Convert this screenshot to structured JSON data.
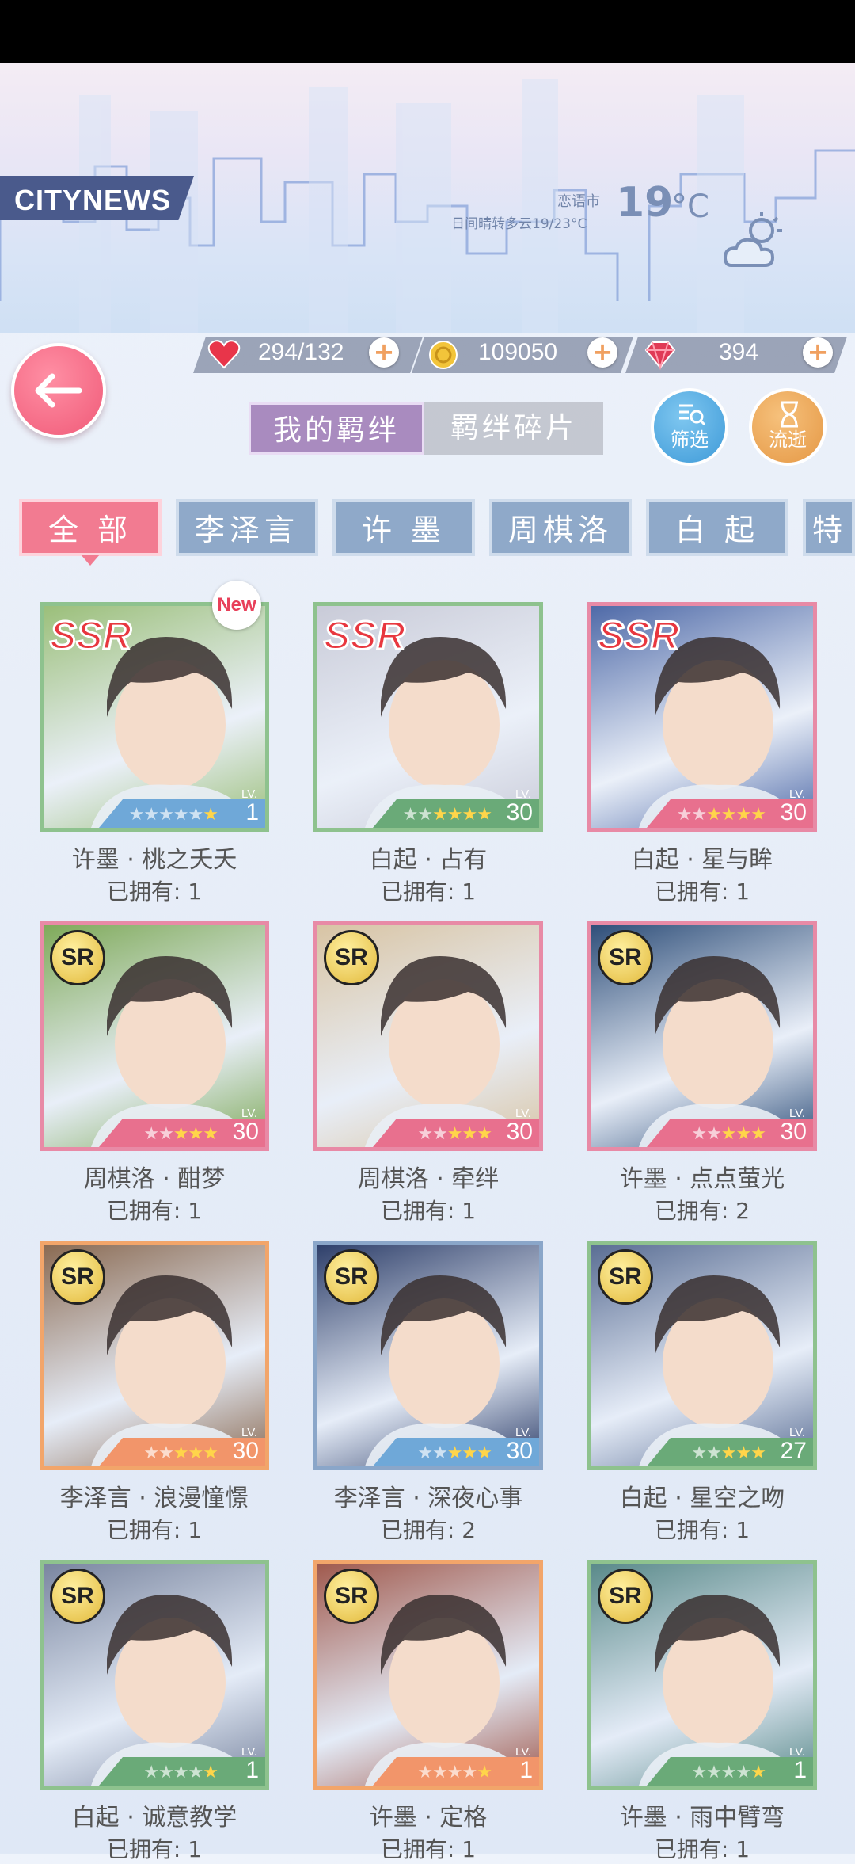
{
  "header": {
    "brand": "CITYNEWS",
    "city": "恋语市",
    "weather_desc": "日间晴转多云19/23°C",
    "temp_value": "19",
    "temp_unit": "°C"
  },
  "resources": {
    "stamina": "294/132",
    "gold": "109050",
    "diamonds": "394"
  },
  "segment_tabs": {
    "active": "我的羁绊",
    "inactive": "羁绊碎片"
  },
  "buttons": {
    "filter": "筛选",
    "flow": "流逝"
  },
  "categories": [
    "全 部",
    "李泽言",
    "许 墨",
    "周棋洛",
    "白 起",
    "特殊"
  ],
  "cards": [
    {
      "name": "许墨 · 桃之夭夭",
      "owned": "已拥有: 1",
      "level": "1",
      "rarity": "SSR",
      "is_new": true,
      "new_label": "New",
      "stars_filled": 1,
      "stars_total": 6,
      "frame": "#8ec28e",
      "band": "#6fa8d8",
      "bg": "#9bbf7a"
    },
    {
      "name": "白起 · 占有",
      "owned": "已拥有: 1",
      "level": "30",
      "rarity": "SSR",
      "stars_filled": 4,
      "stars_total": 6,
      "frame": "#8ec28e",
      "band": "#6aaa78",
      "bg": "#c9cbd8"
    },
    {
      "name": "白起 · 星与眸",
      "owned": "已拥有: 1",
      "level": "30",
      "rarity": "SSR",
      "stars_filled": 4,
      "stars_total": 6,
      "frame": "#e88aa6",
      "band": "#e8708e",
      "bg": "#4f6aa8"
    },
    {
      "name": "周棋洛 · 酣梦",
      "owned": "已拥有: 1",
      "level": "30",
      "rarity": "SR",
      "stars_filled": 3,
      "stars_total": 5,
      "frame": "#e88aa6",
      "band": "#e8708e",
      "bg": "#7faa5a"
    },
    {
      "name": "周棋洛 · 牵绊",
      "owned": "已拥有: 1",
      "level": "30",
      "rarity": "SR",
      "stars_filled": 3,
      "stars_total": 5,
      "frame": "#e88aa6",
      "band": "#e8708e",
      "bg": "#d8c4a4"
    },
    {
      "name": "许墨 · 点点萤光",
      "owned": "已拥有: 2",
      "level": "30",
      "rarity": "SR",
      "stars_filled": 3,
      "stars_total": 5,
      "frame": "#e88aa6",
      "band": "#e8708e",
      "bg": "#2f4f7a"
    },
    {
      "name": "李泽言 · 浪漫憧憬",
      "owned": "已拥有: 1",
      "level": "30",
      "rarity": "SR",
      "stars_filled": 3,
      "stars_total": 5,
      "frame": "#f2a56a",
      "band": "#f2956a",
      "bg": "#8a6a52"
    },
    {
      "name": "李泽言 · 深夜心事",
      "owned": "已拥有: 2",
      "level": "30",
      "rarity": "SR",
      "stars_filled": 3,
      "stars_total": 5,
      "frame": "#8aa6c9",
      "band": "#6fa8d8",
      "bg": "#2e3f6a"
    },
    {
      "name": "白起 · 星空之吻",
      "owned": "已拥有: 1",
      "level": "27",
      "rarity": "SR",
      "stars_filled": 3,
      "stars_total": 5,
      "frame": "#8ec28e",
      "band": "#6aaa78",
      "bg": "#5a6e94"
    },
    {
      "name": "白起 · 诚意教学",
      "owned": "已拥有: 1",
      "level": "1",
      "rarity": "SR",
      "stars_filled": 1,
      "stars_total": 5,
      "frame": "#8ec28e",
      "band": "#6aaa78",
      "bg": "#7a86a0"
    },
    {
      "name": "许墨 · 定格",
      "owned": "已拥有: 1",
      "level": "1",
      "rarity": "SR",
      "stars_filled": 1,
      "stars_total": 5,
      "frame": "#f2a56a",
      "band": "#f2956a",
      "bg": "#a05a4e"
    },
    {
      "name": "许墨 · 雨中臂弯",
      "owned": "已拥有: 1",
      "level": "1",
      "rarity": "SR",
      "stars_filled": 1,
      "stars_total": 5,
      "frame": "#8ec28e",
      "band": "#6aaa78",
      "bg": "#5a8a8a"
    }
  ]
}
